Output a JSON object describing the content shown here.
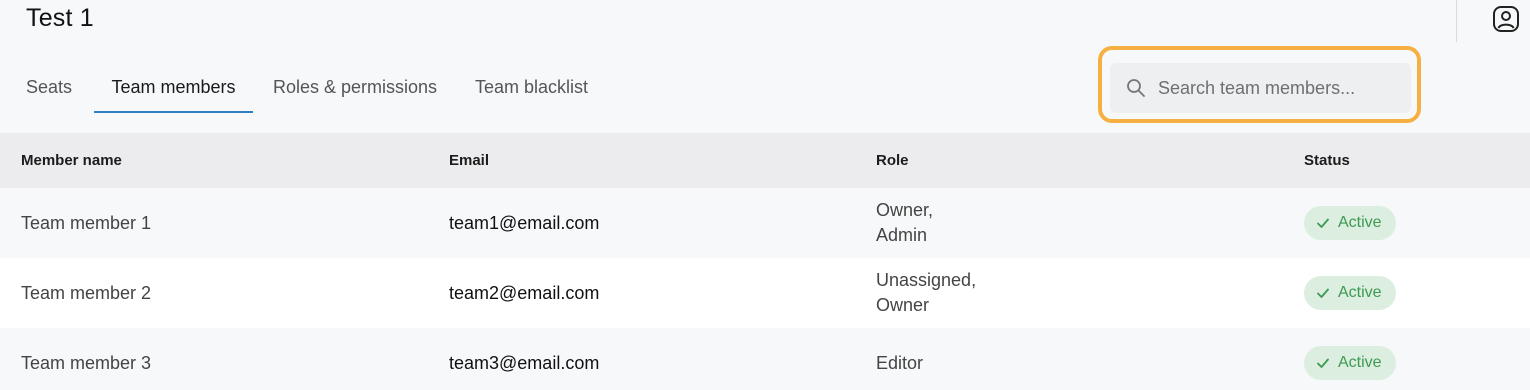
{
  "header": {
    "title": "Test 1"
  },
  "tabs": [
    {
      "label": "Seats"
    },
    {
      "label": "Team members",
      "active": true
    },
    {
      "label": "Roles & permissions"
    },
    {
      "label": "Team blacklist"
    }
  ],
  "search": {
    "placeholder": "Search team members...",
    "value": ""
  },
  "table": {
    "columns": [
      "Member name",
      "Email",
      "Role",
      "Status"
    ],
    "rows": [
      {
        "name": "Team member 1",
        "email": "team1@email.com",
        "role": [
          "Owner,",
          "Admin"
        ],
        "status": "Active"
      },
      {
        "name": "Team member 2",
        "email": "team2@email.com",
        "role": [
          "Unassigned,",
          "Owner"
        ],
        "status": "Active"
      },
      {
        "name": "Team member 3",
        "email": "team3@email.com",
        "role": [
          "Editor"
        ],
        "status": "Active"
      }
    ]
  },
  "colors": {
    "tab_underline": "#2d7fc1",
    "search_highlight": "#f5b041",
    "status_bg": "#dbeee0",
    "status_text": "#3d9a52"
  },
  "icons": {
    "user": "user-account-icon",
    "search": "search-icon",
    "status": "check-icon"
  }
}
